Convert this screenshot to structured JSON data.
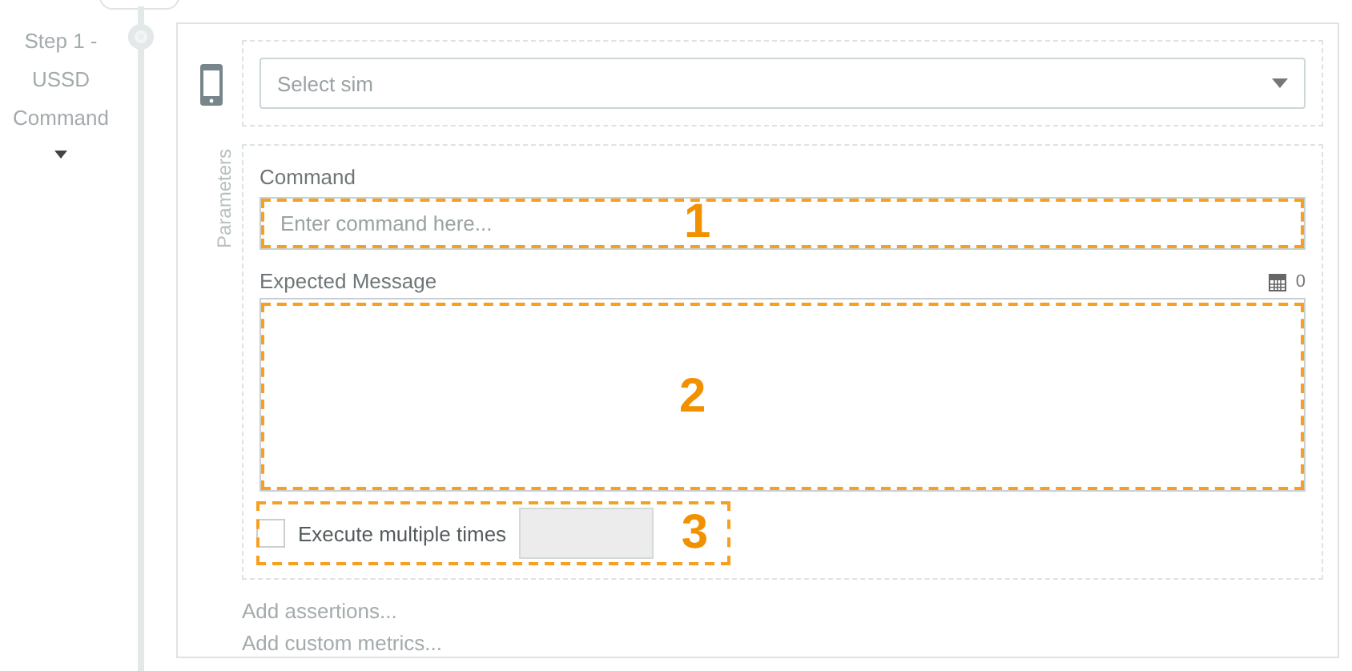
{
  "step": {
    "label": "Step 1 - USSD Command"
  },
  "sim": {
    "placeholder": "Select sim"
  },
  "parameters": {
    "label": "Parameters",
    "command": {
      "label": "Command",
      "placeholder": "Enter command here...",
      "annotation": "1"
    },
    "expected": {
      "label": "Expected Message",
      "counter": "0",
      "annotation": "2"
    },
    "repeat": {
      "label": "Execute multiple times",
      "checked": false,
      "annotation": "3"
    }
  },
  "links": [
    "Add assertions...",
    "Add custom metrics..."
  ]
}
